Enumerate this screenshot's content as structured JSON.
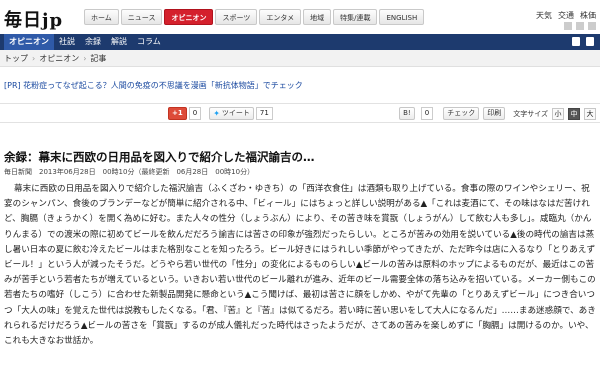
{
  "header": {
    "logo": "毎日jp",
    "nav": [
      "ホーム",
      "ニュース",
      "オピニオン",
      "スポーツ",
      "エンタメ",
      "地域",
      "特集/連載",
      "ENGLISH"
    ],
    "active_nav": "オピニオン",
    "util_links": [
      "天気",
      "交通",
      "株価"
    ]
  },
  "section_nav": {
    "items": [
      "オピニオン",
      "社説",
      "余録",
      "解説",
      "コラム"
    ],
    "active": "オピニオン"
  },
  "breadcrumb": {
    "items": [
      "トップ",
      "オピニオン",
      "記事"
    ]
  },
  "pr": {
    "text": "[PR] 花粉症ってなぜ起こる？人間の免疫の不思議を漫画「新抗体物語」でチェック"
  },
  "share": {
    "gplus_label": "+1",
    "gplus_count": "0",
    "tweet_label": "ツイート",
    "tweet_count": "71",
    "hatena_label": "B!",
    "hatena_count": "0",
    "check_label": "チェック",
    "print_label": "印刷",
    "size_label": "文字サイズ",
    "sizes": [
      "小",
      "中",
      "大"
    ],
    "active_size": "中"
  },
  "article": {
    "title": "余録：幕末に西欧の日用品を図入りで紹介した福沢諭吉の…",
    "meta": "毎日新聞　2013年06月28日　00時10分（最終更新　06月28日　00時10分）",
    "body": "幕末に西欧の日用品を図入りで紹介した福沢諭吉（ふくざわ・ゆきち）の「西洋衣食住」は酒類も取り上げている。食事の際のワインやシェリー、祝宴のシャンパン、食後のブランデーなどが簡単に紹介される中、「ビィール」にはちょっと詳しい説明がある▲「これは麦酒にて、その味はなはだ苦けれど、胸膈（きょうかく）を開く為めに好む。また人々の性分（しょうぶん）により、その苦き味を賞翫（しょうがん）して飲む人も多し」。咸臨丸（かんりんまる）での渡米の際に初めてビールを飲んだだろう諭吉には苦さの印象が強烈だったらしい。ところが苦みの効用を説いている▲後の時代の諭吉は蒸し暑い日本の夏に飲む冷えたビールはまた格別なことを知ったろう。ビール好きにはうれしい季節がやってきたが、ただ昨今は店に入るなり「とりあえずビール！」という人が減ったそうだ。どうやら若い世代の「性分」の変化によるものらしい▲ビールの苦みは原料のホップによるものだが、最近はこの苦みが苦手という若者たちが増えているという。いきおい若い世代のビール離れが進み、近年のビール需要全体の落ち込みを招いている。メーカー側もこの若者たちの嗜好（しこう）に合わせた新製品開発に懸命という▲こう聞けば、最初は苦さに顔をしかめ、やがて先輩の「とりあえずビール」につき合いつつ「大人の味」を覚えた世代は説教もしたくなる。「君、『苦』と『苦』は似てるだろ。若い時に苦い思いをして大人になるんだ」……まあ迷惑顔で、あきれられるだけだろう▲ビールの苦さを「賞翫」するのが成人儀礼だった時代はさったようだが、さてあの苦みを楽しめずに「胸膈」は開けるのか。いや、これも大きなお世話か。"
  }
}
